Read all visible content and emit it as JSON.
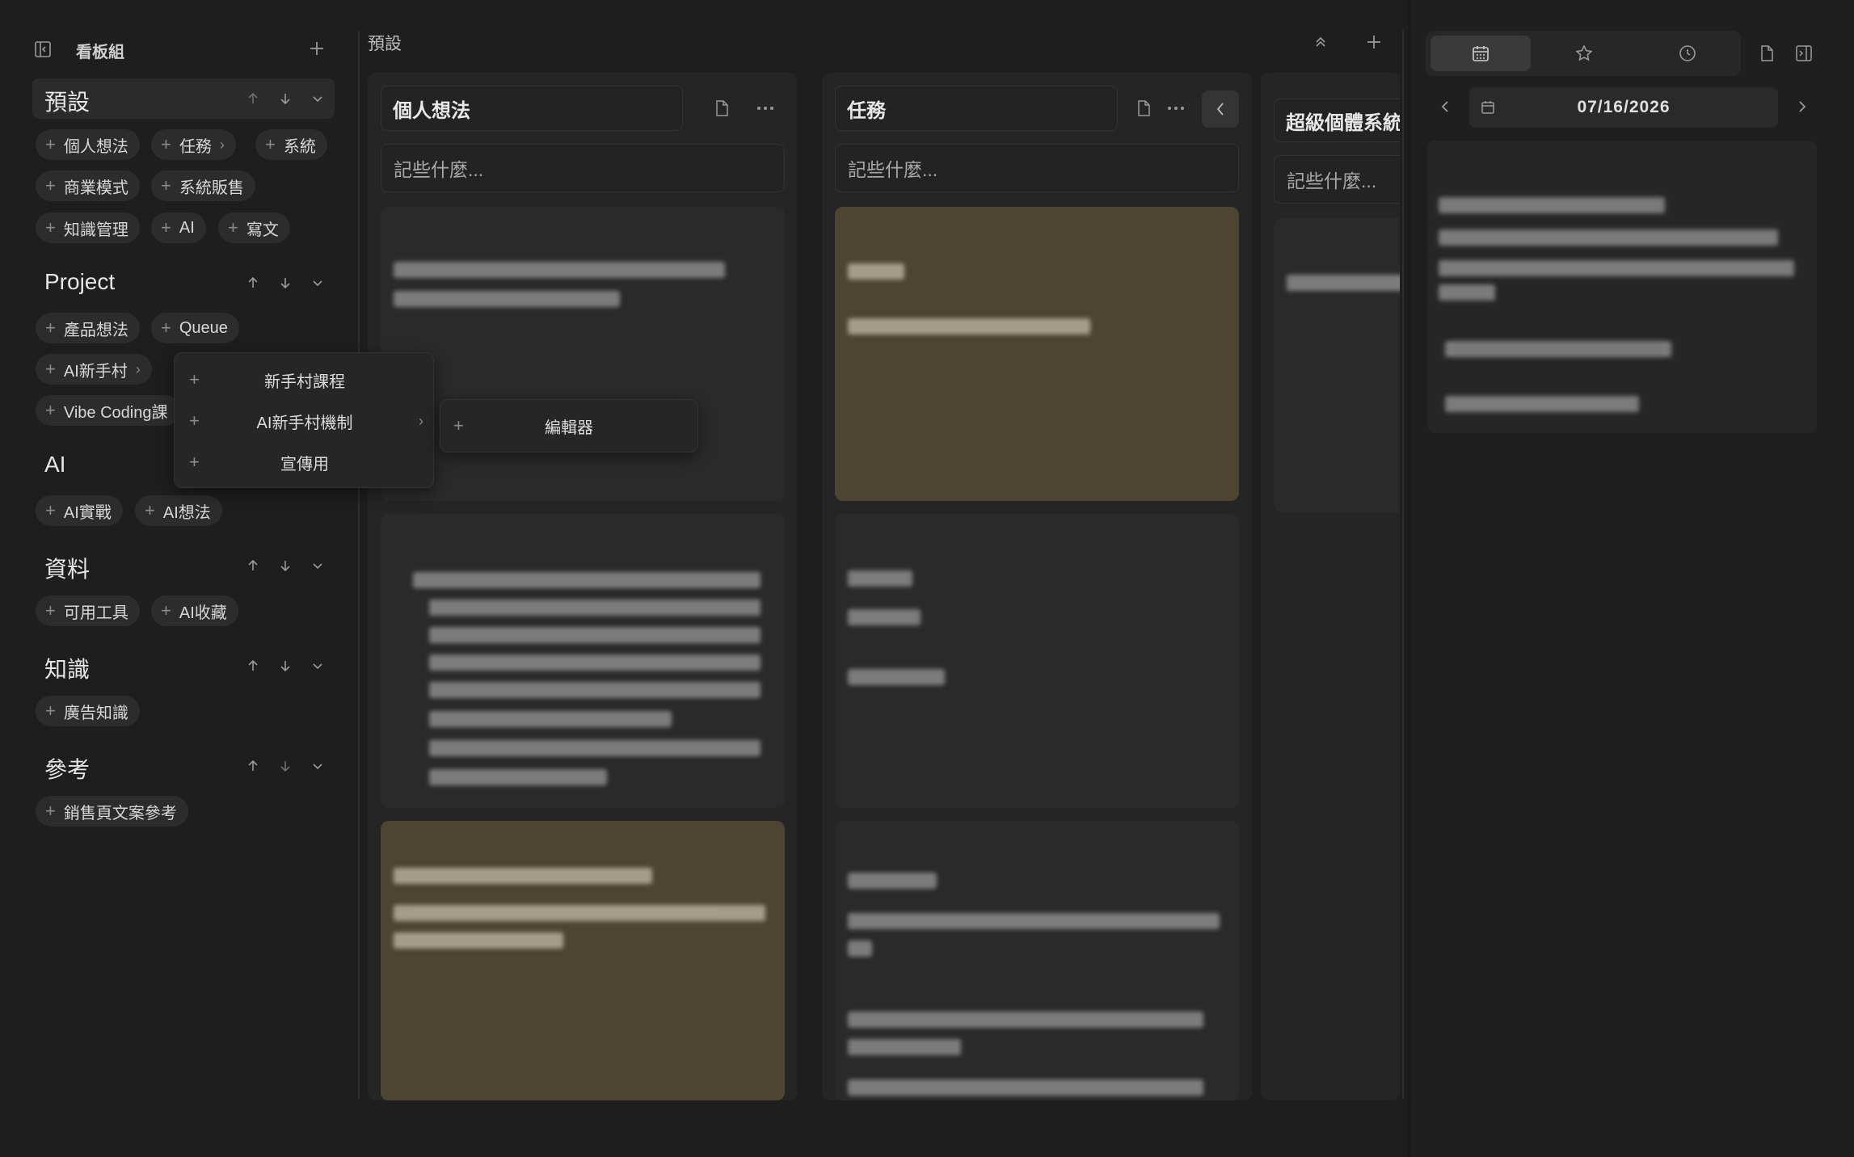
{
  "sidebar": {
    "title": "看板組",
    "groups": [
      {
        "name": "預設",
        "chips": [
          {
            "label": "個人想法"
          },
          {
            "label": "任務"
          },
          {
            "label": "系統"
          },
          {
            "label": "商業模式"
          },
          {
            "label": "系統販售"
          },
          {
            "label": "知識管理"
          },
          {
            "label": "AI"
          },
          {
            "label": "寫文"
          }
        ]
      },
      {
        "name": "Project",
        "chips": [
          {
            "label": "產品想法"
          },
          {
            "label": "Queue"
          },
          {
            "label": "AI新手村"
          },
          {
            "label": "Vibe Coding課"
          }
        ]
      },
      {
        "name": "AI",
        "chips": [
          {
            "label": "AI實戰"
          },
          {
            "label": "AI想法"
          }
        ]
      },
      {
        "name": "資料",
        "chips": [
          {
            "label": "可用工具"
          },
          {
            "label": "AI收藏"
          }
        ]
      },
      {
        "name": "知識",
        "chips": [
          {
            "label": "廣告知識"
          }
        ]
      },
      {
        "name": "參考",
        "chips": [
          {
            "label": "銷售頁文案參考"
          }
        ]
      }
    ]
  },
  "submenu": {
    "items": [
      {
        "label": "新手村課程"
      },
      {
        "label": "AI新手村機制"
      },
      {
        "label": "宣傳用"
      }
    ],
    "nested": {
      "label": "編輯器"
    }
  },
  "board": {
    "title": "預設",
    "columns": [
      {
        "title": "個人想法",
        "placeholder": "記些什麼..."
      },
      {
        "title": "任務",
        "placeholder": "記些什麼..."
      },
      {
        "title": "超級個體系統",
        "placeholder": "記些什麼..."
      }
    ]
  },
  "right_panel": {
    "date": "07/16/2026"
  },
  "icons": {
    "sidebar_toggle": "sidebar-toggle-icon",
    "calendar": "calendar-icon",
    "star": "star-icon",
    "clock": "clock-icon",
    "file": "file-icon",
    "more": "more-icon"
  },
  "colors": {
    "background": "#1e1e1e",
    "column": "#252525",
    "card": "#2a2a2a",
    "card_highlight": "#4d4532"
  }
}
